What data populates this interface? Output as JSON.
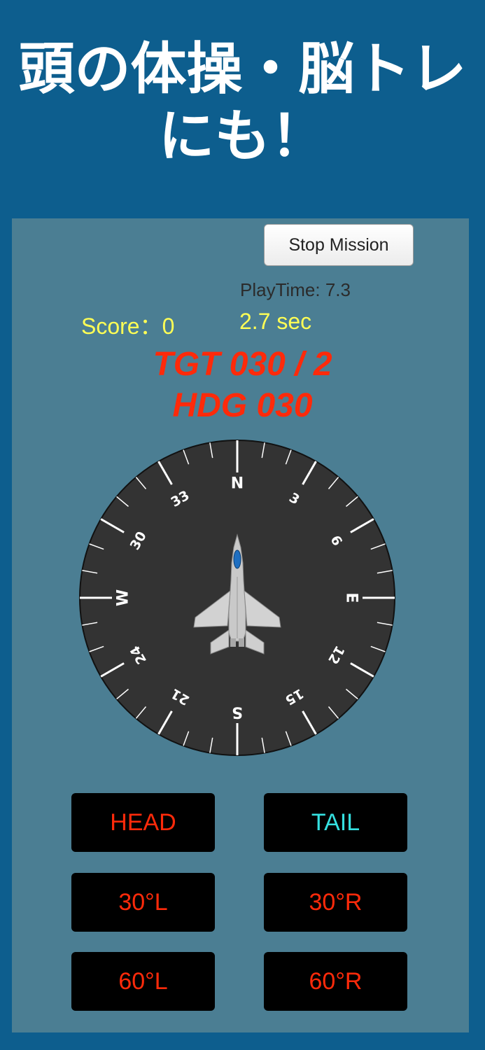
{
  "banner": {
    "line1": "頭の体操・脳トレ",
    "line2": "にも！"
  },
  "header": {
    "stop_label": "Stop Mission",
    "playtime": "PlayTime: 7.3"
  },
  "status": {
    "score": "Score：0",
    "seconds": "2.7 sec"
  },
  "target": {
    "tgt": "TGT 030 / 2",
    "hdg": "HDG 030"
  },
  "compass": {
    "heading_deg": 0,
    "labels": [
      "N",
      "3",
      "6",
      "E",
      "12",
      "15",
      "S",
      "21",
      "24",
      "W",
      "30",
      "33"
    ],
    "aircraft_icon": "fighter-jet-icon"
  },
  "controls": {
    "head": "HEAD",
    "tail": "TAIL",
    "left30": "30°L",
    "right30": "30°R",
    "left60": "60°L",
    "right60": "60°R"
  },
  "colors": {
    "background": "#0d5e8e",
    "panel": "#4b7e93",
    "score": "#ffff55",
    "alert_red": "#ff2a0a",
    "tail_cyan": "#35e0e0",
    "compass_face": "#333333"
  }
}
